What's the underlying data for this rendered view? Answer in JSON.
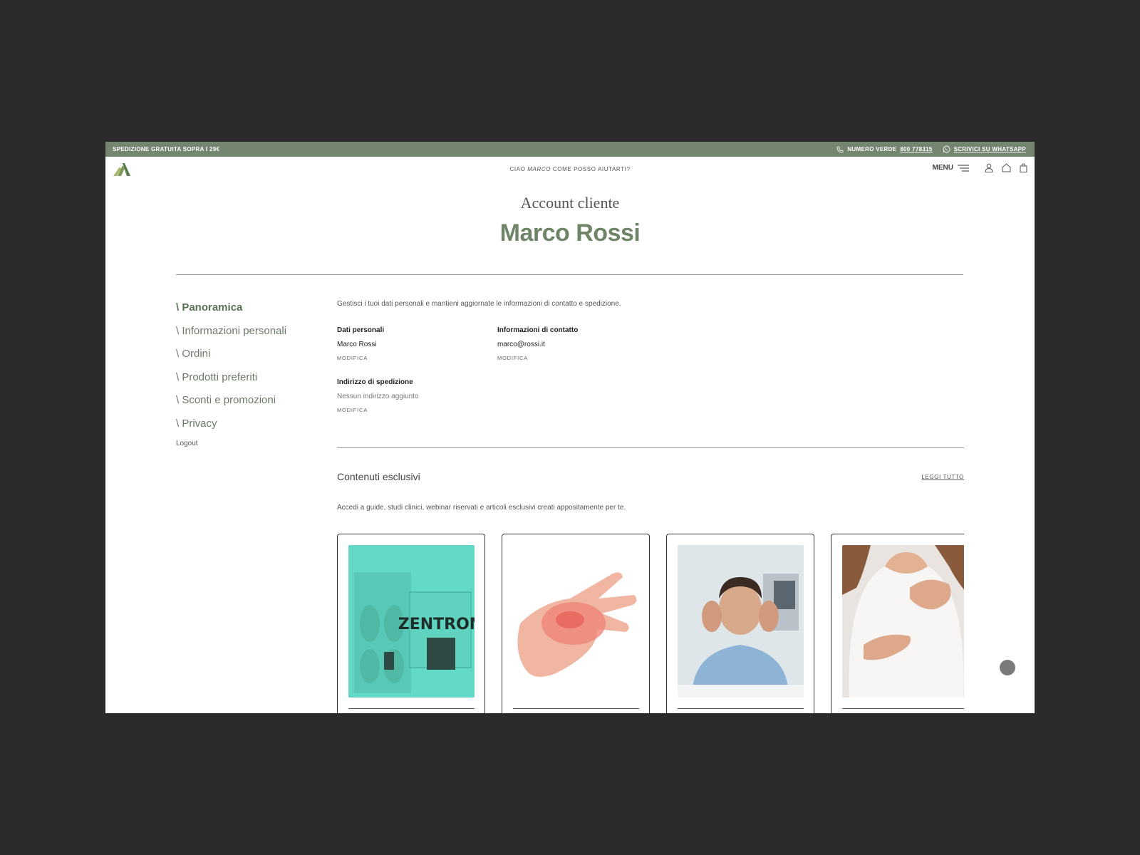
{
  "topbar": {
    "promo": "SPEDIZIONE GRATUITA SOPRA I 29€",
    "phone_label": "NUMERO VERDE",
    "phone_number": "800 778315",
    "whatsapp": "SCRIVICI SU WHATSAPP"
  },
  "header": {
    "greeting_pre": "CIAO",
    "greeting_name": "MARCO",
    "greeting_post": "COME POSSO AIUTARTI?",
    "menu_label": "MENU"
  },
  "hero": {
    "subtitle": "Account cliente",
    "name": "Marco Rossi"
  },
  "sidebar": {
    "items": [
      {
        "label": "\\ Panoramica",
        "active": true
      },
      {
        "label": "\\ Informazioni personali"
      },
      {
        "label": "\\ Ordini"
      },
      {
        "label": "\\ Prodotti preferiti"
      },
      {
        "label": "\\ Sconti e promozioni"
      },
      {
        "label": "\\ Privacy"
      }
    ],
    "logout": "Logout"
  },
  "overview": {
    "intro": "Gestisci i tuoi dati personali e mantieni aggiornate le informazioni di contatto e spedizione.",
    "personal": {
      "label": "Dati personali",
      "value": "Marco Rossi",
      "edit": "MODIFICA"
    },
    "contact": {
      "label": "Informazioni di contatto",
      "value": "marco@rossi.it",
      "edit": "MODIFICA"
    },
    "shipping": {
      "label": "Indirizzo di spedizione",
      "value": "Nessun indirizzo aggiunto",
      "edit": "MODIFICA"
    }
  },
  "exclusive": {
    "title": "Contenuti esclusivi",
    "read_all": "LEGGI TUTTO",
    "description": "Accedi a guide, studi clinici, webinar riservati e articoli esclusivi creati appositamente per te.",
    "cards": [
      {
        "image": "zentron-product-photo",
        "product_text": "ZENTRON"
      },
      {
        "image": "hand-pain-photo"
      },
      {
        "image": "headache-man-photo"
      },
      {
        "image": "chest-pain-woman-photo"
      }
    ]
  },
  "colors": {
    "brand_green": "#74866f",
    "title_green": "#6f8567",
    "background": "#2b2b2b"
  }
}
